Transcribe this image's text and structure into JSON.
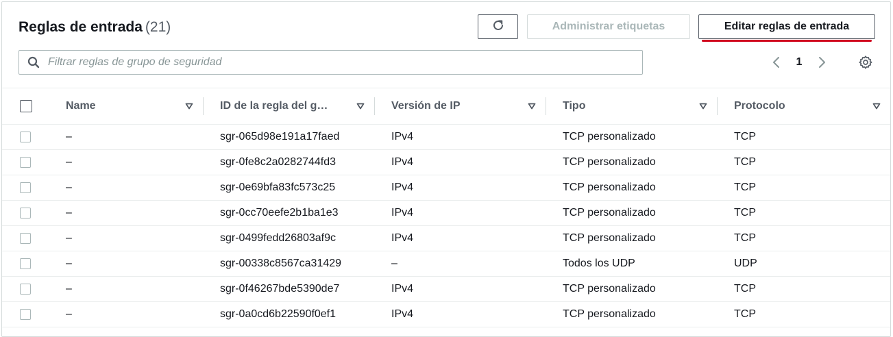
{
  "header": {
    "title": "Reglas de entrada",
    "count": "(21)",
    "refresh_icon": "refresh-icon",
    "manage_tags_label": "Administrar etiquetas",
    "edit_rules_label": "Editar reglas de entrada"
  },
  "search": {
    "placeholder": "Filtrar reglas de grupo de seguridad",
    "value": "",
    "icon": "search-icon"
  },
  "pagination": {
    "current_page": "1",
    "prev_icon": "chevron-left-icon",
    "next_icon": "chevron-right-icon",
    "settings_icon": "gear-icon"
  },
  "colors": {
    "highlight": "#d0021b",
    "border": "#545b64",
    "disabled": "#aab7b8"
  },
  "table": {
    "columns": [
      "Name",
      "ID de la regla del g…",
      "Versión de IP",
      "Tipo",
      "Protocolo"
    ],
    "rows": [
      {
        "name": "–",
        "id": "sgr-065d98e191a17faed",
        "ip_version": "IPv4",
        "type": "TCP personalizado",
        "protocol": "TCP"
      },
      {
        "name": "–",
        "id": "sgr-0fe8c2a0282744fd3",
        "ip_version": "IPv4",
        "type": "TCP personalizado",
        "protocol": "TCP"
      },
      {
        "name": "–",
        "id": "sgr-0e69bfa83fc573c25",
        "ip_version": "IPv4",
        "type": "TCP personalizado",
        "protocol": "TCP"
      },
      {
        "name": "–",
        "id": "sgr-0cc70eefe2b1ba1e3",
        "ip_version": "IPv4",
        "type": "TCP personalizado",
        "protocol": "TCP"
      },
      {
        "name": "–",
        "id": "sgr-0499fedd26803af9c",
        "ip_version": "IPv4",
        "type": "TCP personalizado",
        "protocol": "TCP"
      },
      {
        "name": "–",
        "id": "sgr-00338c8567ca31429",
        "ip_version": "–",
        "type": "Todos los UDP",
        "protocol": "UDP"
      },
      {
        "name": "–",
        "id": "sgr-0f46267bde5390de7",
        "ip_version": "IPv4",
        "type": "TCP personalizado",
        "protocol": "TCP"
      },
      {
        "name": "–",
        "id": "sgr-0a0cd6b22590f0ef1",
        "ip_version": "IPv4",
        "type": "TCP personalizado",
        "protocol": "TCP"
      }
    ]
  }
}
